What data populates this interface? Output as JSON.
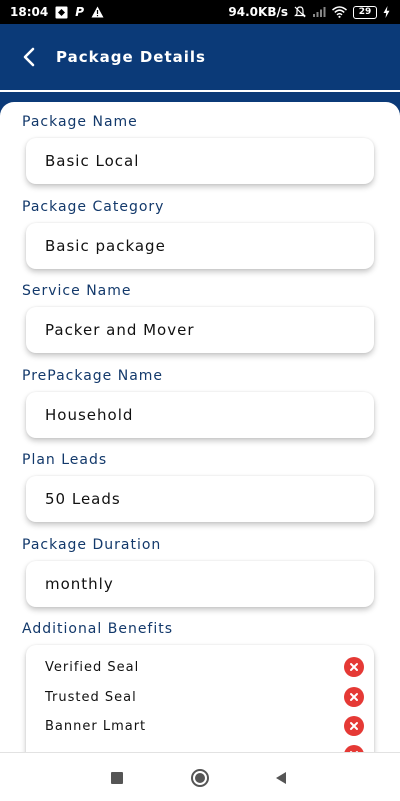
{
  "status_bar": {
    "time": "18:04",
    "speed": "94.0KB/s",
    "battery": "29"
  },
  "header": {
    "title": "Package Details"
  },
  "fields": [
    {
      "label": "Package Name",
      "value": "Basic Local"
    },
    {
      "label": "Package Category",
      "value": "Basic package"
    },
    {
      "label": "Service Name",
      "value": "Packer and Mover"
    },
    {
      "label": "PrePackage Name",
      "value": "Household"
    },
    {
      "label": "Plan Leads",
      "value": "50 Leads"
    },
    {
      "label": "Package Duration",
      "value": "monthly"
    }
  ],
  "benefits": {
    "label": "Additional Benefits",
    "items": [
      "Verified Seal",
      "Trusted Seal",
      "Banner Lmart",
      ""
    ]
  },
  "colors": {
    "primary": "#0b3a78",
    "label": "#13396b",
    "remove": "#e53935"
  },
  "icons": {
    "back": "chevron-left-icon",
    "remove": "close-circle-icon",
    "nav_recent": "square-icon",
    "nav_home": "circle-icon",
    "nav_back": "triangle-left-icon"
  }
}
